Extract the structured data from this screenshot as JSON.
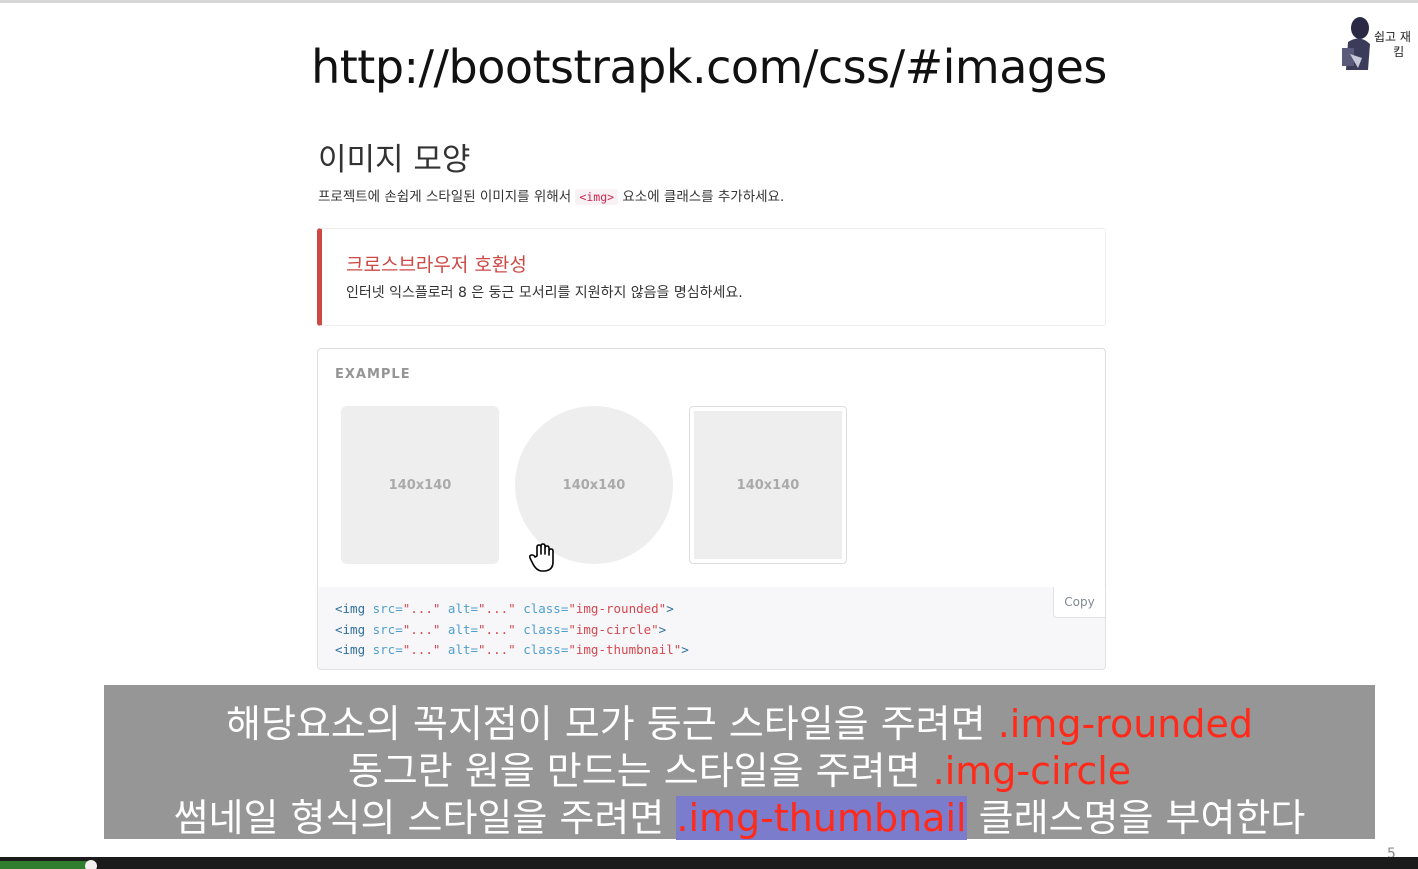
{
  "slide": {
    "title": "http://bootstrapk.com/css/#images",
    "page_number": "5",
    "logo_text": "쉽고 재\n     킴"
  },
  "doc": {
    "heading": "이미지 모양",
    "lead_before": "프로젝트에 손쉽게 스타일된 이미지를 위해서 ",
    "lead_code": "<img>",
    "lead_after": " 요소에 클래스를 추가하세요.",
    "callout": {
      "title": "크로스브라우저 호환성",
      "text": "인터넷 익스플로러 8 은 둥근 모서리를 지원하지 않음을 명심하세요."
    },
    "example": {
      "label": "EXAMPLE",
      "placeholders": [
        "140x140",
        "140x140",
        "140x140"
      ]
    },
    "code": {
      "copy_label": "Copy",
      "lines": [
        {
          "tag_open": "<img",
          "a1": " src=",
          "v1": "\"...\"",
          "a2": " alt=",
          "v2": "\"...\"",
          "a3": " class=",
          "v3": "\"img-rounded\"",
          "tag_close": ">"
        },
        {
          "tag_open": "<img",
          "a1": " src=",
          "v1": "\"...\"",
          "a2": " alt=",
          "v2": "\"...\"",
          "a3": " class=",
          "v3": "\"img-circle\"",
          "tag_close": ">"
        },
        {
          "tag_open": "<img",
          "a1": " src=",
          "v1": "\"...\"",
          "a2": " alt=",
          "v2": "\"...\"",
          "a3": " class=",
          "v3": "\"img-thumbnail\"",
          "tag_close": ">"
        }
      ]
    }
  },
  "caption": {
    "line1_text": "해당요소의 꼭지점이 모가 둥근 스타일을 주려면 ",
    "line1_class": ".img-rounded",
    "line2_text": "동그란 원을 만드는 스타일을 주려면 ",
    "line2_class": ".img-circle",
    "line3_text": "썸네일 형식의 스타일을 주려면 ",
    "line3_class": ".img-thumbnail",
    "line3_tail": " 클래스명을 부여한다"
  },
  "colors": {
    "callout_accent": "#ce4844",
    "caption_bg": "#969696",
    "caption_class": "#ff2a1a",
    "caption_highlight": "#7c7ccc"
  },
  "icons": [
    "hand-cursor-icon",
    "logo-icon"
  ]
}
